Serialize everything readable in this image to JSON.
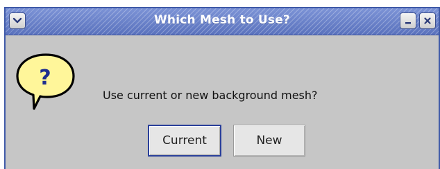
{
  "window": {
    "title": "Which Mesh to Use?",
    "menu_icon": "chevron-down-icon",
    "minimize_icon": "minimize-icon",
    "close_icon": "close-icon"
  },
  "dialog": {
    "icon": "question-bubble-icon",
    "icon_glyph": "?",
    "message": "Use current or new background mesh?",
    "buttons": {
      "current_label": "Current",
      "new_label": "New"
    }
  },
  "colors": {
    "titlebar": "#6a82c9",
    "dialog_bg": "#c6c6c6",
    "bubble_fill": "#fff69a",
    "focus_border": "#2a3f9a"
  }
}
